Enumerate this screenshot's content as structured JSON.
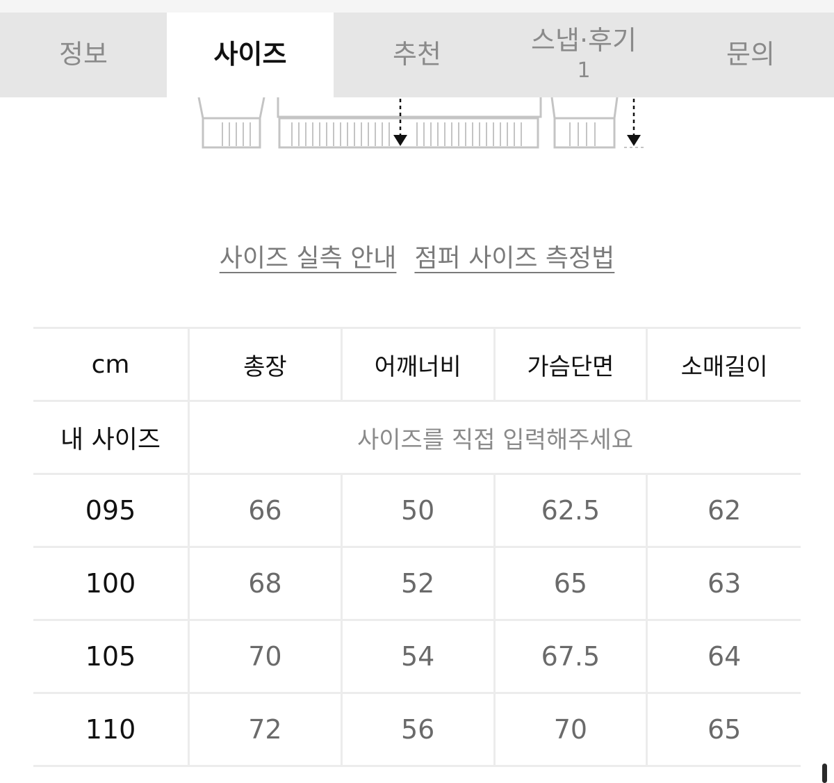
{
  "tabs": [
    {
      "label": "정보",
      "count": "",
      "active": false
    },
    {
      "label": "사이즈",
      "count": "",
      "active": true
    },
    {
      "label": "추천",
      "count": "",
      "active": false
    },
    {
      "label": "스냅·후기",
      "count": "1",
      "active": false
    },
    {
      "label": "문의",
      "count": "",
      "active": false
    }
  ],
  "links": {
    "size_guide": "사이즈 실측 안내",
    "measure_method": "점퍼 사이즈 측정법"
  },
  "table": {
    "unit": "cm",
    "headers": [
      "총장",
      "어깨너비",
      "가슴단면",
      "소매길이"
    ],
    "my_size_label": "내 사이즈",
    "my_size_prompt": "사이즈를 직접 입력해주세요",
    "rows": [
      {
        "size": "095",
        "values": [
          "66",
          "50",
          "62.5",
          "62"
        ]
      },
      {
        "size": "100",
        "values": [
          "68",
          "52",
          "65",
          "63"
        ]
      },
      {
        "size": "105",
        "values": [
          "70",
          "54",
          "67.5",
          "64"
        ]
      },
      {
        "size": "110",
        "values": [
          "72",
          "56",
          "70",
          "65"
        ]
      }
    ]
  },
  "colors": {
    "tab_bar": "#e6e6e6",
    "tab_active": "#ffffff",
    "muted_text": "#8a8a8a",
    "border": "#ececec"
  }
}
